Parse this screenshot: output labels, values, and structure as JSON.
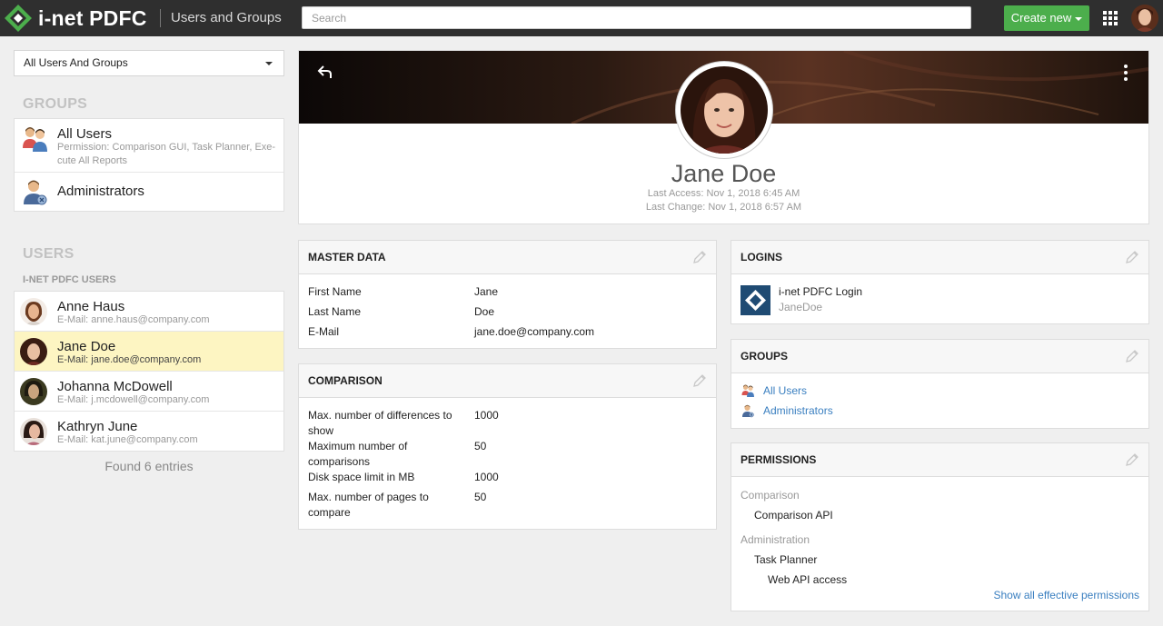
{
  "app": {
    "brand": "i-net PDFC",
    "module": "Users and Groups"
  },
  "topbar": {
    "search_placeholder": "Search",
    "create_label": "Create new"
  },
  "sidebar": {
    "filter_value": "All Users And Groups",
    "groups_title": "GROUPS",
    "groups": [
      {
        "name": "All Users",
        "description": "Permission: Comparison GUI, Task Planner, Exe- cute All Reports"
      },
      {
        "name": "Administrators"
      }
    ],
    "users_title": "USERS",
    "users_subtitle": "I-NET PDFC USERS",
    "users": [
      {
        "name": "Anne Haus",
        "email": "E-Mail: anne.haus@company.com"
      },
      {
        "name": "Jane Doe",
        "email": "E-Mail: jane.doe@company.com",
        "selected": true
      },
      {
        "name": "Johanna McDowell",
        "email": "E-Mail: j.mcdowell@company.com"
      },
      {
        "name": "Kathryn June",
        "email": "E-Mail: kat.june@company.com"
      }
    ],
    "found_text": "Found 6 entries"
  },
  "profile": {
    "name": "Jane Doe",
    "last_access": "Last Access: Nov 1, 2018 6:45 AM",
    "last_change": "Last Change: Nov 1, 2018 6:57 AM"
  },
  "master_data": {
    "title": "MASTER DATA",
    "rows": [
      {
        "key": "First Name",
        "value": "Jane"
      },
      {
        "key": "Last Name",
        "value": "Doe"
      },
      {
        "key": "E-Mail",
        "value": "jane.doe@company.com"
      }
    ]
  },
  "comparison": {
    "title": "COMPARISON",
    "rows": [
      {
        "key": "Max. number of differences to show",
        "value": "1000"
      },
      {
        "key": "Maximum number of comparisons",
        "value": "50"
      },
      {
        "key": "Disk space limit in MB",
        "value": "1000"
      },
      {
        "key": "Max. number of pages to compare",
        "value": "50"
      }
    ]
  },
  "logins": {
    "title": "LOGINS",
    "items": [
      {
        "name": "i-net PDFC Login",
        "user": "JaneDoe"
      }
    ]
  },
  "groups_card": {
    "title": "GROUPS",
    "items": [
      "All Users",
      "Administrators"
    ]
  },
  "permissions": {
    "title": "PERMISSIONS",
    "cat1": "Comparison",
    "cat1_item1": "Comparison API",
    "cat2": "Administration",
    "cat2_item1": "Task Planner",
    "cat2_item1_child": "Web API access",
    "show_all": "Show all effective permissions"
  },
  "colors": {
    "topbar": "#2f2f2f",
    "create_button": "#4cae4c",
    "selected_row": "#fdf5c2",
    "link": "#3a7fc0",
    "logo": "#4cae4c"
  }
}
